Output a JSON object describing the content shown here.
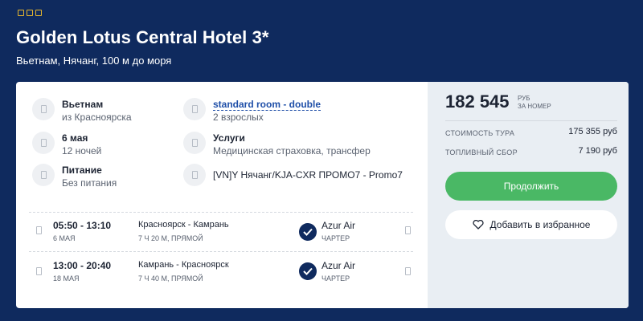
{
  "hotel": {
    "stars": 3,
    "title": "Golden Lotus Central Hotel 3*",
    "subtitle": "Вьетнам, Нячанг, 100 м до моря"
  },
  "info": {
    "country": {
      "label": "Вьетнам",
      "value": "из Красноярска",
      "icon": "placeholder-icon"
    },
    "room": {
      "label": "standard room - double",
      "value": "2 взрослых",
      "icon": "placeholder-icon"
    },
    "date": {
      "label": "6 мая",
      "value": "12 ночей",
      "icon": "placeholder-icon"
    },
    "services": {
      "label": "Услуги",
      "value": "Медицинская страховка, трансфер",
      "icon": "placeholder-icon"
    },
    "meal": {
      "label": "Питание",
      "value": "Без питания",
      "icon": "placeholder-icon"
    },
    "promo": {
      "value": "[VN]Y Нячанг/KJA-CXR ПРОМО7 - Promo7",
      "icon": "placeholder-icon"
    }
  },
  "flights": [
    {
      "time": "05:50 - 13:10",
      "date": "6 МАЯ",
      "route": "Красноярск - Камрань",
      "duration": "7 Ч 20 М, ПРЯМОЙ",
      "airline": "Azur Air",
      "type": "ЧАРТЕР"
    },
    {
      "time": "13:00 - 20:40",
      "date": "18 МАЯ",
      "route": "Камрань - Красноярск",
      "duration": "7 Ч 40 М, ПРЯМОЙ",
      "airline": "Azur Air",
      "type": "ЧАРТЕР"
    }
  ],
  "pricing": {
    "total": "182 545",
    "currency": "РУБ",
    "per": "ЗА НОМЕР",
    "tour_label": "СТОИМОСТЬ ТУРА",
    "tour_value": "175 355 руб",
    "fuel_label": "ТОПЛИВНЫЙ СБОР",
    "fuel_value": "7 190 руб",
    "continue_label": "Продолжить",
    "favorite_label": "Добавить в избранное"
  },
  "colors": {
    "background": "#0f2a5e",
    "accent_green": "#4ab865",
    "link_blue": "#1f4fa8",
    "star": "#e4b52e"
  }
}
